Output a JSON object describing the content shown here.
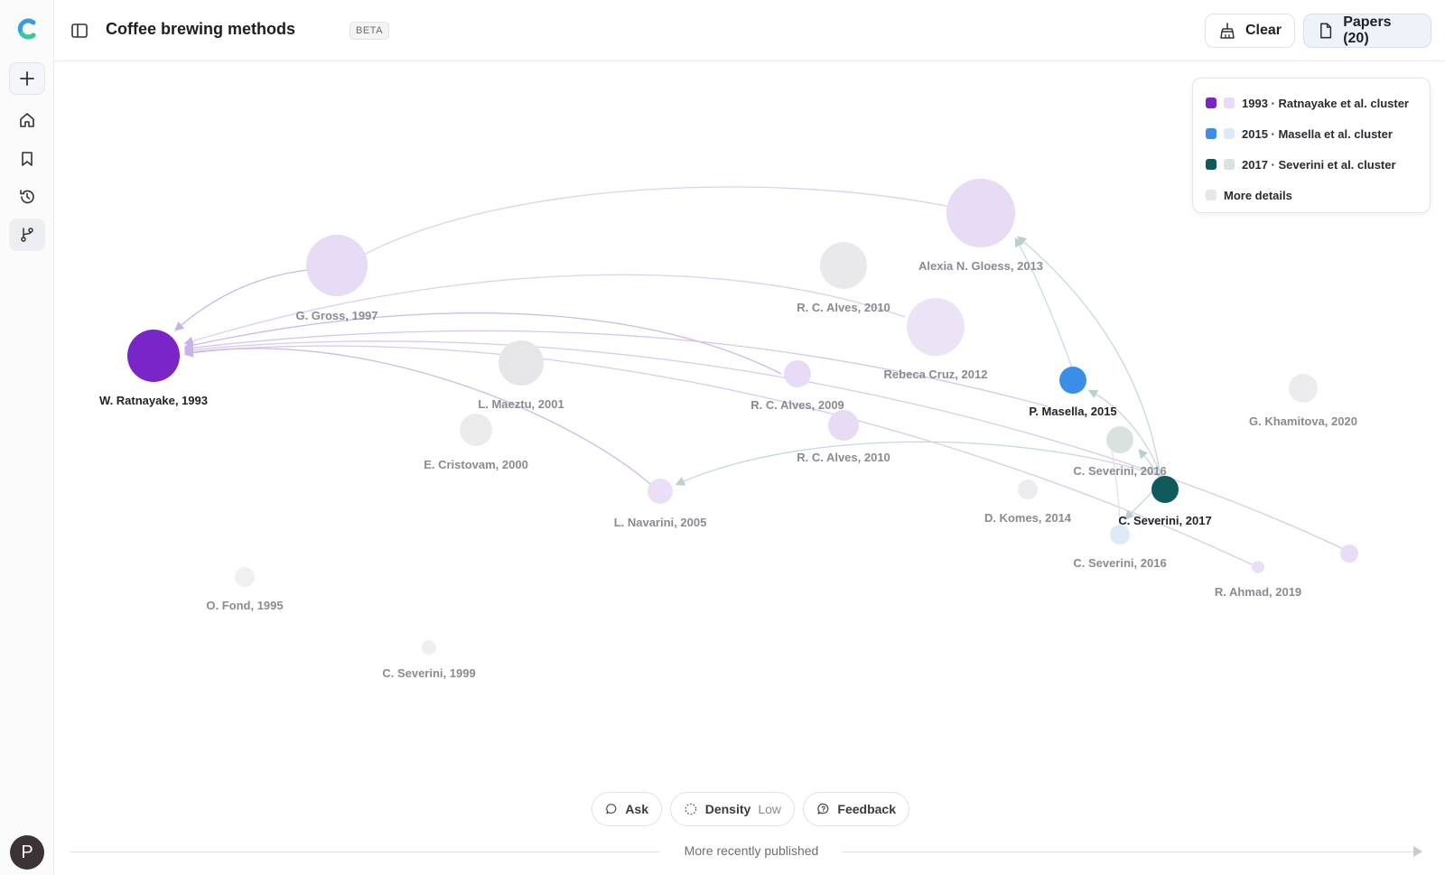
{
  "app": {
    "title": "Coffee brewing methods",
    "badge": "BETA"
  },
  "header": {
    "clear_label": "Clear",
    "papers_label": "Papers (20)"
  },
  "rail": {
    "avatar_initial": "P"
  },
  "legend": {
    "items": [
      {
        "label": "1993 · Ratnayake et al. cluster",
        "color": "#7a25c8",
        "light_color": "#e7dbf5"
      },
      {
        "label": "2015 · Masella et al. cluster",
        "color": "#3b8ee6",
        "light_color": "#dbe9f8"
      },
      {
        "label": "2017 · Severini et al. cluster",
        "color": "#0f5a5a",
        "light_color": "#d9e2e1"
      },
      {
        "label": "More details",
        "color": "#e6e6e8"
      }
    ]
  },
  "graph": {
    "nodes": [
      {
        "label": "W. Ratnayake, 1993",
        "cluster": "1993",
        "emphasis": "strong"
      },
      {
        "label": "G. Gross, 1997",
        "cluster": "1993",
        "emphasis": "light"
      },
      {
        "label": "Alexia N. Gloess, 2013",
        "cluster": "1993",
        "emphasis": "light"
      },
      {
        "label": "R. C. Alves, 2010",
        "cluster": "none",
        "emphasis": "grey"
      },
      {
        "label": "Rebeca Cruz, 2012",
        "cluster": "1993",
        "emphasis": "light"
      },
      {
        "label": "L. Maeztu, 2001",
        "cluster": "none",
        "emphasis": "grey"
      },
      {
        "label": "R. C. Alves, 2009",
        "cluster": "1993",
        "emphasis": "light"
      },
      {
        "label": "R. C. Alves, 2010",
        "cluster": "1993",
        "emphasis": "light"
      },
      {
        "label": "E. Cristovam, 2000",
        "cluster": "none",
        "emphasis": "grey"
      },
      {
        "label": "L. Navarini, 2005",
        "cluster": "1993",
        "emphasis": "light"
      },
      {
        "label": "P. Masella, 2015",
        "cluster": "2015",
        "emphasis": "strong"
      },
      {
        "label": "G. Khamitova, 2020",
        "cluster": "none",
        "emphasis": "grey"
      },
      {
        "label": "C. Severini, 2016",
        "cluster": "2017",
        "emphasis": "light"
      },
      {
        "label": "C. Severini, 2017",
        "cluster": "2017",
        "emphasis": "strong"
      },
      {
        "label": "D. Komes, 2014",
        "cluster": "none",
        "emphasis": "grey"
      },
      {
        "label": "C. Severini, 2016",
        "cluster": "2015",
        "emphasis": "light"
      },
      {
        "label": "R. Ahmad, 2019",
        "cluster": "1993",
        "emphasis": "light"
      },
      {
        "label": "O. Fond, 1995",
        "cluster": "none",
        "emphasis": "grey"
      },
      {
        "label": "C. Severini, 1999",
        "cluster": "none",
        "emphasis": "grey"
      }
    ]
  },
  "toolbar": {
    "ask_label": "Ask",
    "density_label": "Density",
    "density_value": "Low",
    "feedback_label": "Feedback"
  },
  "axis": {
    "caption": "More recently published"
  }
}
